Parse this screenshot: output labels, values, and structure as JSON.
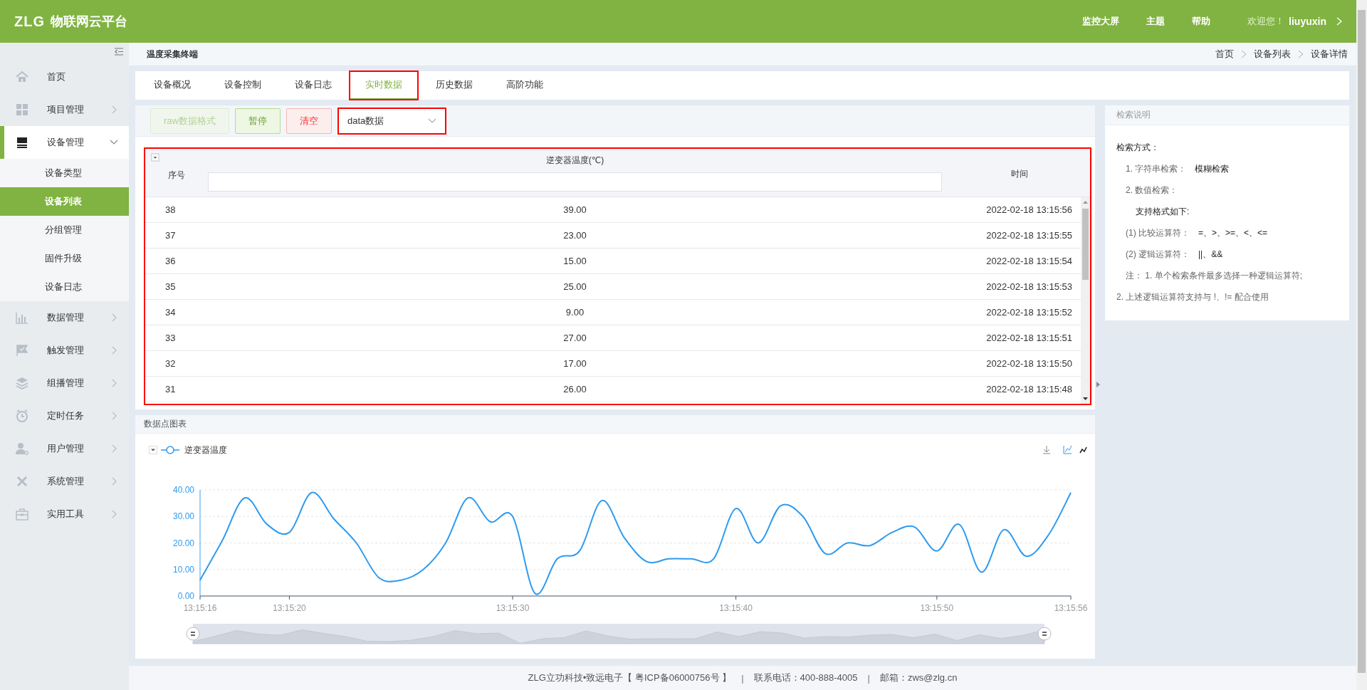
{
  "header": {
    "logo": "ZLG",
    "title": "物联网云平台",
    "nav": [
      "监控大屏",
      "主题",
      "帮助"
    ],
    "welcome": "欢迎您！",
    "user": "liuyuxin"
  },
  "sidebar": {
    "items": [
      {
        "label": "首页"
      },
      {
        "label": "项目管理",
        "expanded": false
      },
      {
        "label": "设备管理",
        "expanded": true,
        "children": [
          {
            "label": "设备类型",
            "selected": false
          },
          {
            "label": "设备列表",
            "selected": true
          },
          {
            "label": "分组管理",
            "selected": false
          },
          {
            "label": "固件升级",
            "selected": false
          },
          {
            "label": "设备日志",
            "selected": false
          }
        ]
      },
      {
        "label": "数据管理",
        "expanded": false
      },
      {
        "label": "触发管理",
        "expanded": false
      },
      {
        "label": "组播管理",
        "expanded": false
      },
      {
        "label": "定时任务",
        "expanded": false
      },
      {
        "label": "用户管理",
        "expanded": false
      },
      {
        "label": "系统管理",
        "expanded": false
      },
      {
        "label": "实用工具",
        "expanded": false
      }
    ]
  },
  "breadcrumb": {
    "title": "温度采集终端",
    "path": [
      "首页",
      "设备列表",
      "设备详情"
    ]
  },
  "tabs": [
    {
      "label": "设备概况",
      "selected": false
    },
    {
      "label": "设备控制",
      "selected": false
    },
    {
      "label": "设备日志",
      "selected": false
    },
    {
      "label": "实时数据",
      "selected": true
    },
    {
      "label": "历史数据",
      "selected": false
    },
    {
      "label": "高阶功能",
      "selected": false
    }
  ],
  "toolbar": {
    "buttons": [
      {
        "label": "raw数据格式",
        "kind": "format",
        "disabled": true
      },
      {
        "label": "暂停",
        "kind": "pause",
        "disabled": false
      },
      {
        "label": "清空",
        "kind": "clear",
        "disabled": false
      }
    ],
    "select": {
      "value": "data数据"
    }
  },
  "table": {
    "columns": [
      "序号",
      "逆变器温度(℃)",
      "时间"
    ],
    "rows": [
      {
        "seq": "38",
        "value": "39.00",
        "time": "2022-02-18 13:15:56"
      },
      {
        "seq": "37",
        "value": "23.00",
        "time": "2022-02-18 13:15:55"
      },
      {
        "seq": "36",
        "value": "15.00",
        "time": "2022-02-18 13:15:54"
      },
      {
        "seq": "35",
        "value": "25.00",
        "time": "2022-02-18 13:15:53"
      },
      {
        "seq": "34",
        "value": "9.00",
        "time": "2022-02-18 13:15:52"
      },
      {
        "seq": "33",
        "value": "27.00",
        "time": "2022-02-18 13:15:51"
      },
      {
        "seq": "32",
        "value": "17.00",
        "time": "2022-02-18 13:15:50"
      },
      {
        "seq": "31",
        "value": "26.00",
        "time": "2022-02-18 13:15:48"
      }
    ]
  },
  "chart_panel": {
    "title": "数据点图表",
    "chart_data": {
      "type": "line",
      "categories": [
        "13:15:16",
        null,
        null,
        null,
        "13:15:20",
        null,
        null,
        null,
        null,
        null,
        null,
        null,
        null,
        null,
        "13:15:30",
        null,
        null,
        null,
        null,
        null,
        null,
        null,
        null,
        null,
        "13:15:40",
        null,
        null,
        null,
        null,
        null,
        null,
        null,
        null,
        "13:15:50",
        null,
        null,
        null,
        null,
        null,
        "13:15:56"
      ],
      "series": [
        {
          "name": "逆变器温度",
          "color": "#2d9bf0",
          "values": [
            6,
            21,
            37,
            27,
            24,
            39,
            29,
            20,
            7,
            6,
            10,
            20,
            37,
            28,
            30,
            1,
            14,
            17,
            36,
            22,
            13,
            14,
            14,
            14,
            33,
            20,
            34,
            30,
            16,
            20,
            19,
            24,
            26,
            17,
            27,
            9,
            25,
            15,
            23,
            39
          ]
        }
      ],
      "ylim": [
        0,
        40
      ],
      "grid": true,
      "yticks": [
        {
          "value": 0,
          "label": "0.00"
        },
        {
          "value": 10,
          "label": "10.00"
        },
        {
          "value": 20,
          "label": "20.00"
        },
        {
          "value": 30,
          "label": "30.00"
        },
        {
          "value": 40,
          "label": "40.00"
        }
      ]
    }
  },
  "search_help": {
    "title": "检索说明",
    "lines": [
      {
        "kind": "heading",
        "text": "检索方式："
      },
      {
        "kind": "item",
        "label": "1. 字符串检索：",
        "value": "模糊检索"
      },
      {
        "kind": "item",
        "label": "2. 数值检索："
      },
      {
        "kind": "subheading",
        "text": "支持格式如下:"
      },
      {
        "kind": "item",
        "label": "(1) 比较运算符：",
        "value": "=、>、>=、<、<="
      },
      {
        "kind": "item",
        "label": "(2) 逻辑运算符：",
        "value": "||、&&"
      },
      {
        "kind": "note",
        "text": "注： 1. 单个检索条件最多选择一种逻辑运算符;"
      },
      {
        "kind": "flush",
        "text": "2. 上述逻辑运算符支持与 !、!= 配合使用"
      }
    ]
  },
  "footer": [
    {
      "kind": "text",
      "text": "ZLG立功科技•致远电子【 粤ICP备06000756号 】"
    },
    {
      "kind": "separator",
      "text": "|"
    },
    {
      "kind": "text",
      "text": "联系电话：400-888-4005"
    },
    {
      "kind": "separator",
      "text": "|"
    },
    {
      "kind": "text",
      "text": "邮箱：zws@zlg.cn"
    }
  ]
}
